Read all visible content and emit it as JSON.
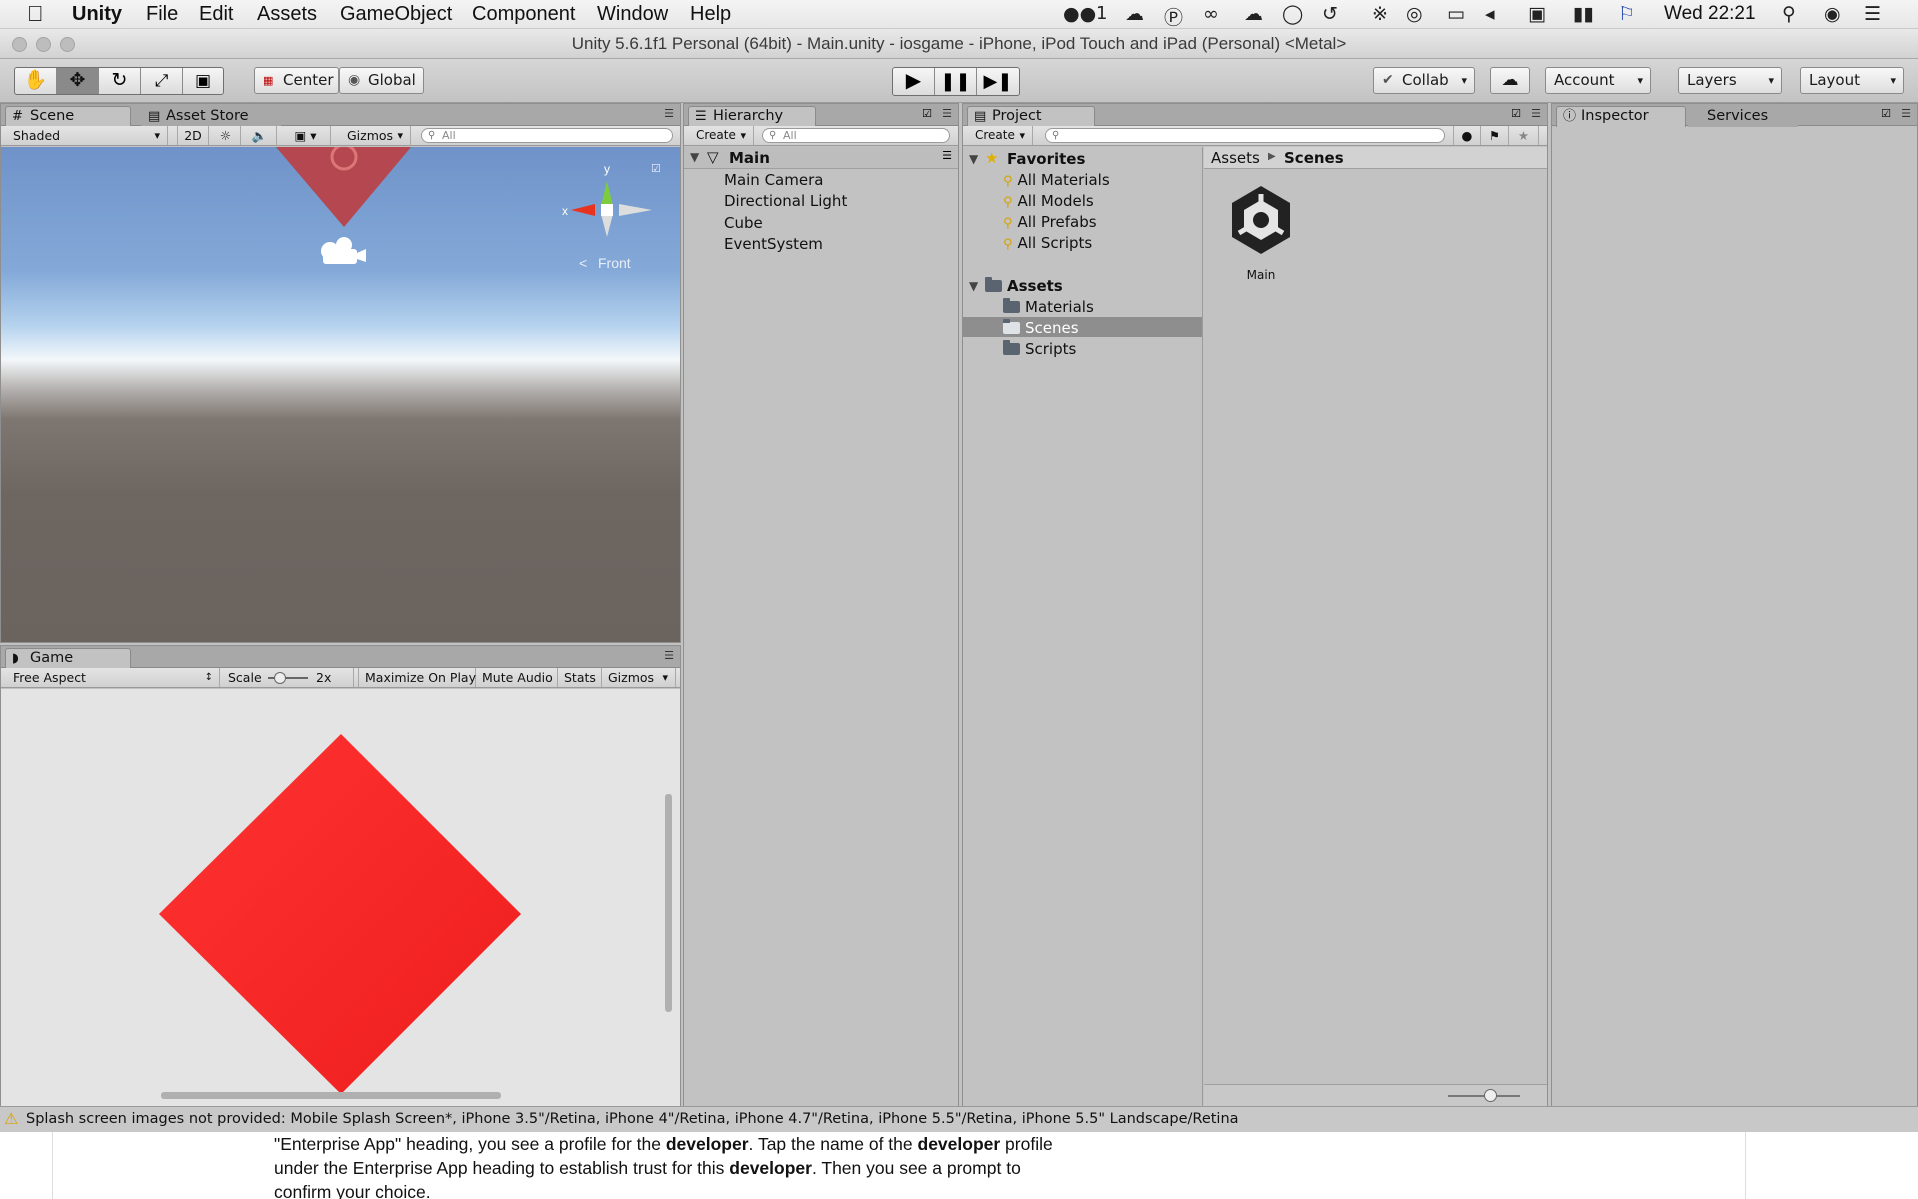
{
  "menubar": {
    "app": "Unity",
    "items": [
      "File",
      "Edit",
      "Assets",
      "GameObject",
      "Component",
      "Window",
      "Help"
    ],
    "wechat_count": "1",
    "clock": "Wed 22:21"
  },
  "window": {
    "title": "Unity 5.6.1f1 Personal (64bit) - Main.unity - iosgame - iPhone, iPod Touch and iPad (Personal) <Metal>"
  },
  "toolbar": {
    "pivot": "Center",
    "space": "Global",
    "collab": "Collab",
    "account": "Account",
    "layers": "Layers",
    "layout": "Layout"
  },
  "scene_panel": {
    "tabs": [
      "Scene",
      "Asset Store"
    ],
    "shading": "Shaded",
    "mode_2d": "2D",
    "gizmos": "Gizmos",
    "search_placeholder": "All",
    "axis_x": "x",
    "axis_y": "y",
    "view_label": "Front"
  },
  "game_panel": {
    "tab": "Game",
    "aspect": "Free Aspect",
    "scale_label": "Scale",
    "scale_value": "2x",
    "maximize": "Maximize On Play",
    "mute": "Mute Audio",
    "stats": "Stats",
    "gizmos": "Gizmos"
  },
  "hierarchy": {
    "tab": "Hierarchy",
    "create": "Create",
    "search_placeholder": "All",
    "scene": "Main",
    "items": [
      "Main Camera",
      "Directional Light",
      "Cube",
      "EventSystem"
    ]
  },
  "project": {
    "tab": "Project",
    "create": "Create",
    "favorites_label": "Favorites",
    "favorites": [
      "All Materials",
      "All Models",
      "All Prefabs",
      "All Scripts"
    ],
    "assets_label": "Assets",
    "folders": [
      "Materials",
      "Scenes",
      "Scripts"
    ],
    "selected_folder": "Scenes",
    "breadcrumb": [
      "Assets",
      "Scenes"
    ],
    "files": [
      {
        "name": "Main",
        "icon": "unity-logo-icon"
      }
    ]
  },
  "inspector": {
    "tabs": [
      "Inspector",
      "Services"
    ]
  },
  "status": {
    "message": "Splash screen images not provided: Mobile Splash Screen*, iPhone 3.5\"/Retina, iPhone 4\"/Retina, iPhone 4.7\"/Retina, iPhone 5.5\"/Retina, iPhone 5.5\" Landscape/Retina"
  },
  "background_doc": {
    "line1_a": "\"Enterprise App\" heading, you see a profile for the ",
    "line1_b": "developer",
    "line1_c": ". Tap the name of the ",
    "line1_d": "developer",
    "line1_e": " profile",
    "line2_a": "under the Enterprise App heading to establish trust for this ",
    "line2_b": "developer",
    "line2_c": ". Then you see a prompt to",
    "line3": "confirm your choice."
  },
  "colors": {
    "cube_red": "#ff2b2b",
    "sky_blue": "#6f93c9",
    "ground": "#6e6661",
    "panel_gray": "#c2c2c2",
    "selection": "#8e8e8e"
  }
}
